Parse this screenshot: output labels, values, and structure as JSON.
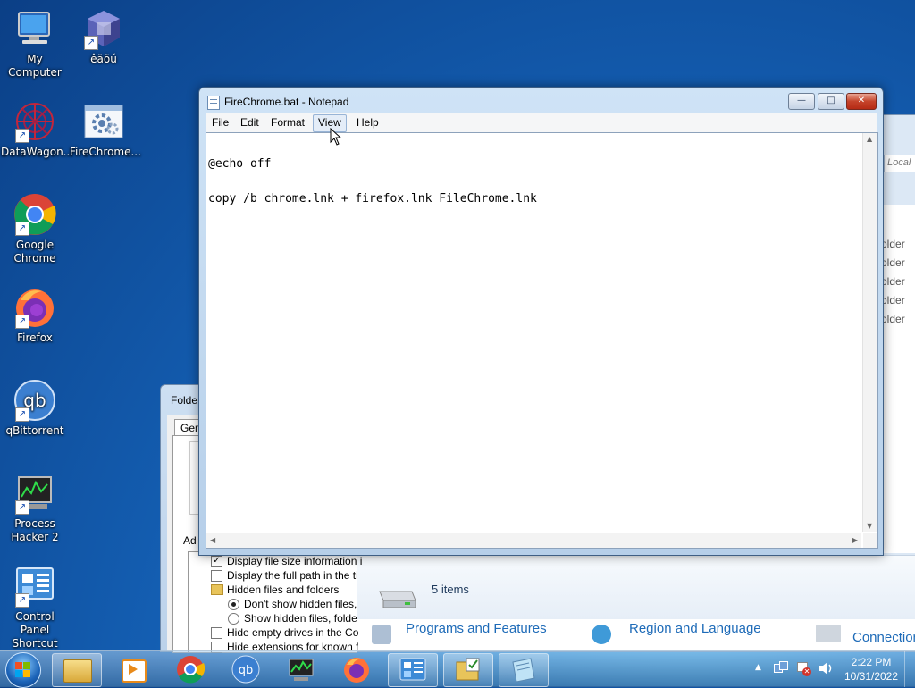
{
  "desktop": {
    "icons": [
      {
        "label": "My Computer"
      },
      {
        "label": "êäõú"
      },
      {
        "label": "DataWagon..."
      },
      {
        "label": "FireChrome..."
      },
      {
        "label": "Google Chrome"
      },
      {
        "label": "Firefox"
      },
      {
        "label": "qBittorrent"
      },
      {
        "label": "Process Hacker 2"
      },
      {
        "label": "Control Panel Shortcut"
      }
    ]
  },
  "background_windows": {
    "folder_options": {
      "title": "Folde",
      "tab": "Gen",
      "advanced_label": "Ad",
      "options": [
        {
          "text": "Display file size information i",
          "checked": true
        },
        {
          "text": "Display the full path in the ti",
          "checked": false
        },
        {
          "text": "Hidden files and folders",
          "folder": true
        },
        {
          "text": "Don't show hidden files,",
          "radio": true,
          "selected": true
        },
        {
          "text": "Show hidden files, folde",
          "radio": true,
          "selected": false
        },
        {
          "text": "Hide empty drives in the Co",
          "checked": false
        },
        {
          "text": "Hide extensions for known f",
          "checked": false
        }
      ]
    },
    "explorer": {
      "search_placeholder": "Local",
      "folder_entries": [
        "older",
        "older",
        "older",
        "older",
        "older"
      ],
      "status": "5 items",
      "control_panel_items": [
        "Programs and Features",
        "Region and Language",
        "Connection"
      ]
    }
  },
  "notepad": {
    "title": "FireChrome.bat - Notepad",
    "menu": [
      "File",
      "Edit",
      "Format",
      "View",
      "Help"
    ],
    "active_menu": "View",
    "lines": [
      "@echo off",
      "copy /b chrome.lnk + firefox.lnk FileChrome.lnk"
    ],
    "buttons": {
      "minimize": "—",
      "maximize": "□",
      "close": "✕"
    }
  },
  "taskbar": {
    "clock_time": "2:22 PM",
    "clock_date": "10/31/2022",
    "tray_icons": [
      "show-hidden-icons",
      "network-icon",
      "action-center-flag-icon",
      "volume-icon"
    ]
  }
}
